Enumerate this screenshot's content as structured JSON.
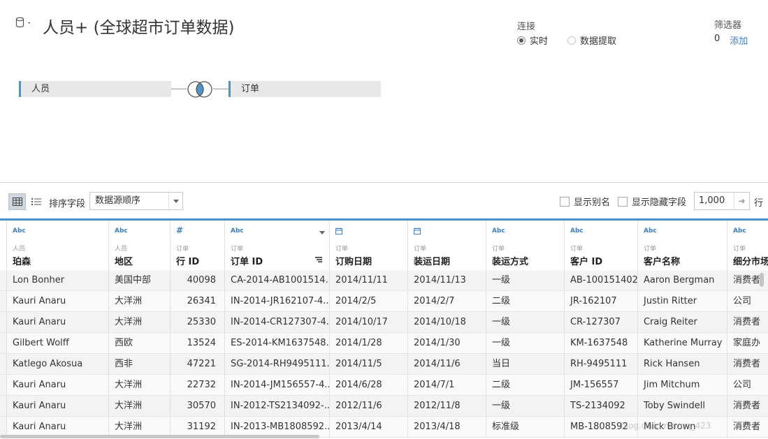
{
  "header": {
    "title": "人员+ (全球超市订单数据)"
  },
  "connection": {
    "label": "连接",
    "options": [
      "实时",
      "数据提取"
    ],
    "selected": "实时"
  },
  "filters": {
    "label": "筛选器",
    "count": "0",
    "add_label": "添加"
  },
  "join": {
    "left_table": "人员",
    "right_table": "订单",
    "type": "inner"
  },
  "toolbar": {
    "sort_label": "排序字段",
    "sort_value": "数据源顺序",
    "show_alias_label": "显示别名",
    "show_hidden_label": "显示隐藏字段",
    "rows_value": "1,000",
    "rows_suffix": "行"
  },
  "columns": [
    {
      "type": "Abc",
      "source": "人员",
      "name": "珀森"
    },
    {
      "type": "Abc",
      "source": "人员",
      "name": "地区"
    },
    {
      "type": "#",
      "source": "订单",
      "name": "行 ID"
    },
    {
      "type": "Abc",
      "source": "订单",
      "name": "订单 ID"
    },
    {
      "type": "date",
      "source": "订单",
      "name": "订购日期"
    },
    {
      "type": "date",
      "source": "订单",
      "name": "装运日期"
    },
    {
      "type": "Abc",
      "source": "订单",
      "name": "装运方式"
    },
    {
      "type": "Abc",
      "source": "订单",
      "name": "客户 ID"
    },
    {
      "type": "Abc",
      "source": "订单",
      "name": "客户名称"
    },
    {
      "type": "Abc",
      "source": "订单",
      "name": "细分市场"
    }
  ],
  "rows": [
    [
      "Lon Bonher",
      "美国中部",
      "40098",
      "CA-2014-AB1001514...",
      "2014/11/11",
      "2014/11/13",
      "一级",
      "AB-100151402",
      "Aaron Bergman",
      "消费者"
    ],
    [
      "Kauri Anaru",
      "大洋洲",
      "26341",
      "IN-2014-JR162107-4...",
      "2014/2/5",
      "2014/2/7",
      "二级",
      "JR-162107",
      "Justin Ritter",
      "公司"
    ],
    [
      "Kauri Anaru",
      "大洋洲",
      "25330",
      "IN-2014-CR127307-4...",
      "2014/10/17",
      "2014/10/18",
      "一级",
      "CR-127307",
      "Craig Reiter",
      "消费者"
    ],
    [
      "Gilbert Wolff",
      "西欧",
      "13524",
      "ES-2014-KM1637548...",
      "2014/1/28",
      "2014/1/30",
      "一级",
      "KM-1637548",
      "Katherine Murray",
      "家庭办"
    ],
    [
      "Katlego Akosua",
      "西非",
      "47221",
      "SG-2014-RH9495111...",
      "2014/11/5",
      "2014/11/6",
      "当日",
      "RH-9495111",
      "Rick Hansen",
      "消费者"
    ],
    [
      "Kauri Anaru",
      "大洋洲",
      "22732",
      "IN-2014-JM156557-4...",
      "2014/6/28",
      "2014/7/1",
      "二级",
      "JM-156557",
      "Jim Mitchum",
      "公司"
    ],
    [
      "Kauri Anaru",
      "大洋洲",
      "30570",
      "IN-2012-TS2134092-...",
      "2012/11/6",
      "2012/11/8",
      "一级",
      "TS-2134092",
      "Toby Swindell",
      "消费者"
    ],
    [
      "Kauri Anaru",
      "大洋洲",
      "31192",
      "IN-2013-MB1808592...",
      "2013/4/14",
      "2013/4/18",
      "标准级",
      "MB-1808592",
      "Mick Brown",
      "消费者"
    ]
  ],
  "watermark": "blog.csdn.net/qq_423"
}
